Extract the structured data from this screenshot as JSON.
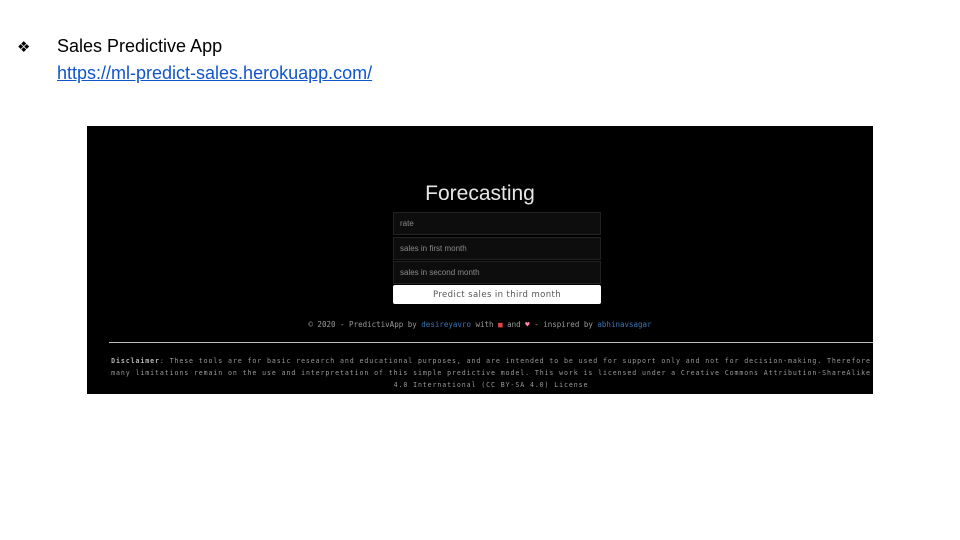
{
  "slide": {
    "bullet_icon": "four-diamond-bullet-icon",
    "bullet_glyph": "❖",
    "title": "Sales Predictive App",
    "link": "https://ml-predict-sales.herokuapp.com/"
  },
  "app": {
    "title": "Forecasting",
    "fields": {
      "rate_placeholder": "rate",
      "first_month_placeholder": "sales in first month",
      "second_month_placeholder": "sales in second month"
    },
    "predict_button": "Predict sales in third month",
    "footer": {
      "prefix": "© 2020 - PredictivApp by",
      "author": "desireyavro",
      "with": "with",
      "and": "and",
      "inspired": "- inspired by",
      "inspired_author": "abhinavsagar"
    },
    "disclaimer": {
      "label": "Disclaimer",
      "text": ": These tools are for basic research and educational purposes, and are intended to be used for support only and not for decision-making. Therefore many limitations remain on the use and interpretation of this simple predictive model. This work is licensed under a Creative Commons Attribution-ShareAlike 4.0 International (CC BY-SA 4.0) License"
    }
  },
  "colors": {
    "link": "#1155cc",
    "app_background": "#000000",
    "footer_link": "#3b74b8"
  }
}
